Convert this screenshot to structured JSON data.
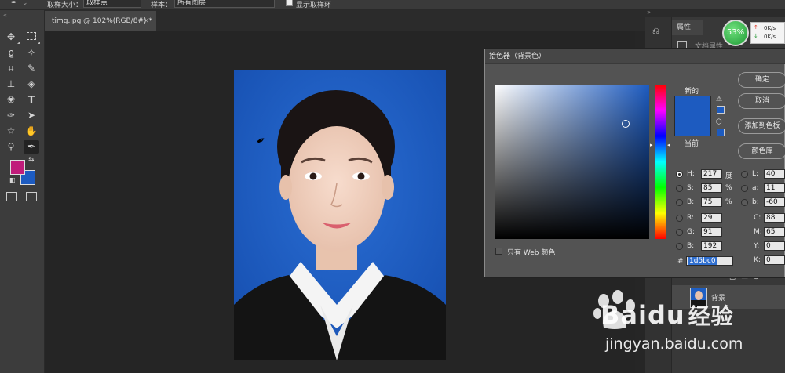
{
  "options_bar": {
    "sample_size_label": "取样大小：",
    "sample_size_value": "取样点",
    "sample_label": "样本：",
    "sample_value": "所有图层",
    "show_ring_label": "显示取样环"
  },
  "document": {
    "tab_title": "timg.jpg @ 102%(RGB/8#) *",
    "tab_close": "×"
  },
  "right_panel": {
    "properties_label": "属性",
    "doc_props_label": "文档属性",
    "layer_name": "背景"
  },
  "net_widget": {
    "percent": "53%",
    "up_speed": "0K/s",
    "down_speed": "0K/s"
  },
  "color_picker": {
    "title": "拾色器（背景色）",
    "new_label": "新的",
    "current_label": "当前",
    "ok_label": "确定",
    "cancel_label": "取消",
    "add_swatch_label": "添加到色板",
    "libraries_label": "颜色库",
    "web_only_label": "只有 Web 颜色",
    "hex_prefix": "#",
    "hex_value": "1d5bc0",
    "new_color": "#1d5bc0",
    "current_color": "#1d5bc0",
    "fields": {
      "H": {
        "label": "H:",
        "value": "217",
        "unit": "度"
      },
      "S": {
        "label": "S:",
        "value": "85",
        "unit": "%"
      },
      "Bv": {
        "label": "B:",
        "value": "75",
        "unit": "%"
      },
      "R": {
        "label": "R:",
        "value": "29"
      },
      "G": {
        "label": "G:",
        "value": "91"
      },
      "Bc": {
        "label": "B:",
        "value": "192"
      },
      "L": {
        "label": "L:",
        "value": "40"
      },
      "a": {
        "label": "a:",
        "value": "11"
      },
      "b": {
        "label": "b:",
        "value": "-60"
      },
      "C": {
        "label": "C:",
        "value": "88"
      },
      "M": {
        "label": "M:",
        "value": "65"
      },
      "Y": {
        "label": "Y:",
        "value": "0"
      },
      "K": {
        "label": "K:",
        "value": "0"
      }
    }
  },
  "watermark": {
    "brand": "Bai",
    "brand_tail": "du",
    "suffix": "经验",
    "url": "jingyan.baidu.com"
  },
  "colors": {
    "foreground": "#c01c7a",
    "background": "#1d5bc0",
    "photo_bg": "#1f5fc3"
  }
}
